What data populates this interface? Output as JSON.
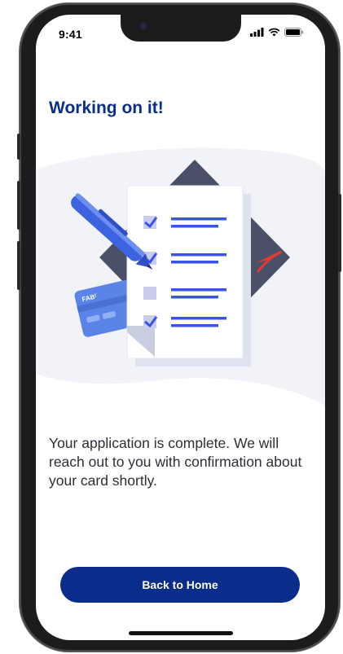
{
  "status_bar": {
    "time": "9:41"
  },
  "page": {
    "title": "Working on it!",
    "message": "Your application is complete. We will reach out to you with confirmation about your card shortly."
  },
  "illustration": {
    "card_brand": "FABᶠ"
  },
  "actions": {
    "back_home_label": "Back to Home"
  },
  "icons": [
    "signal-icon",
    "wifi-icon",
    "battery-icon",
    "checkbox-icon",
    "pen-icon",
    "card-icon"
  ],
  "colors": {
    "brand": "#0a2d8c",
    "accent": "#3a52e6",
    "checklist_lines": "#3a52e6"
  }
}
